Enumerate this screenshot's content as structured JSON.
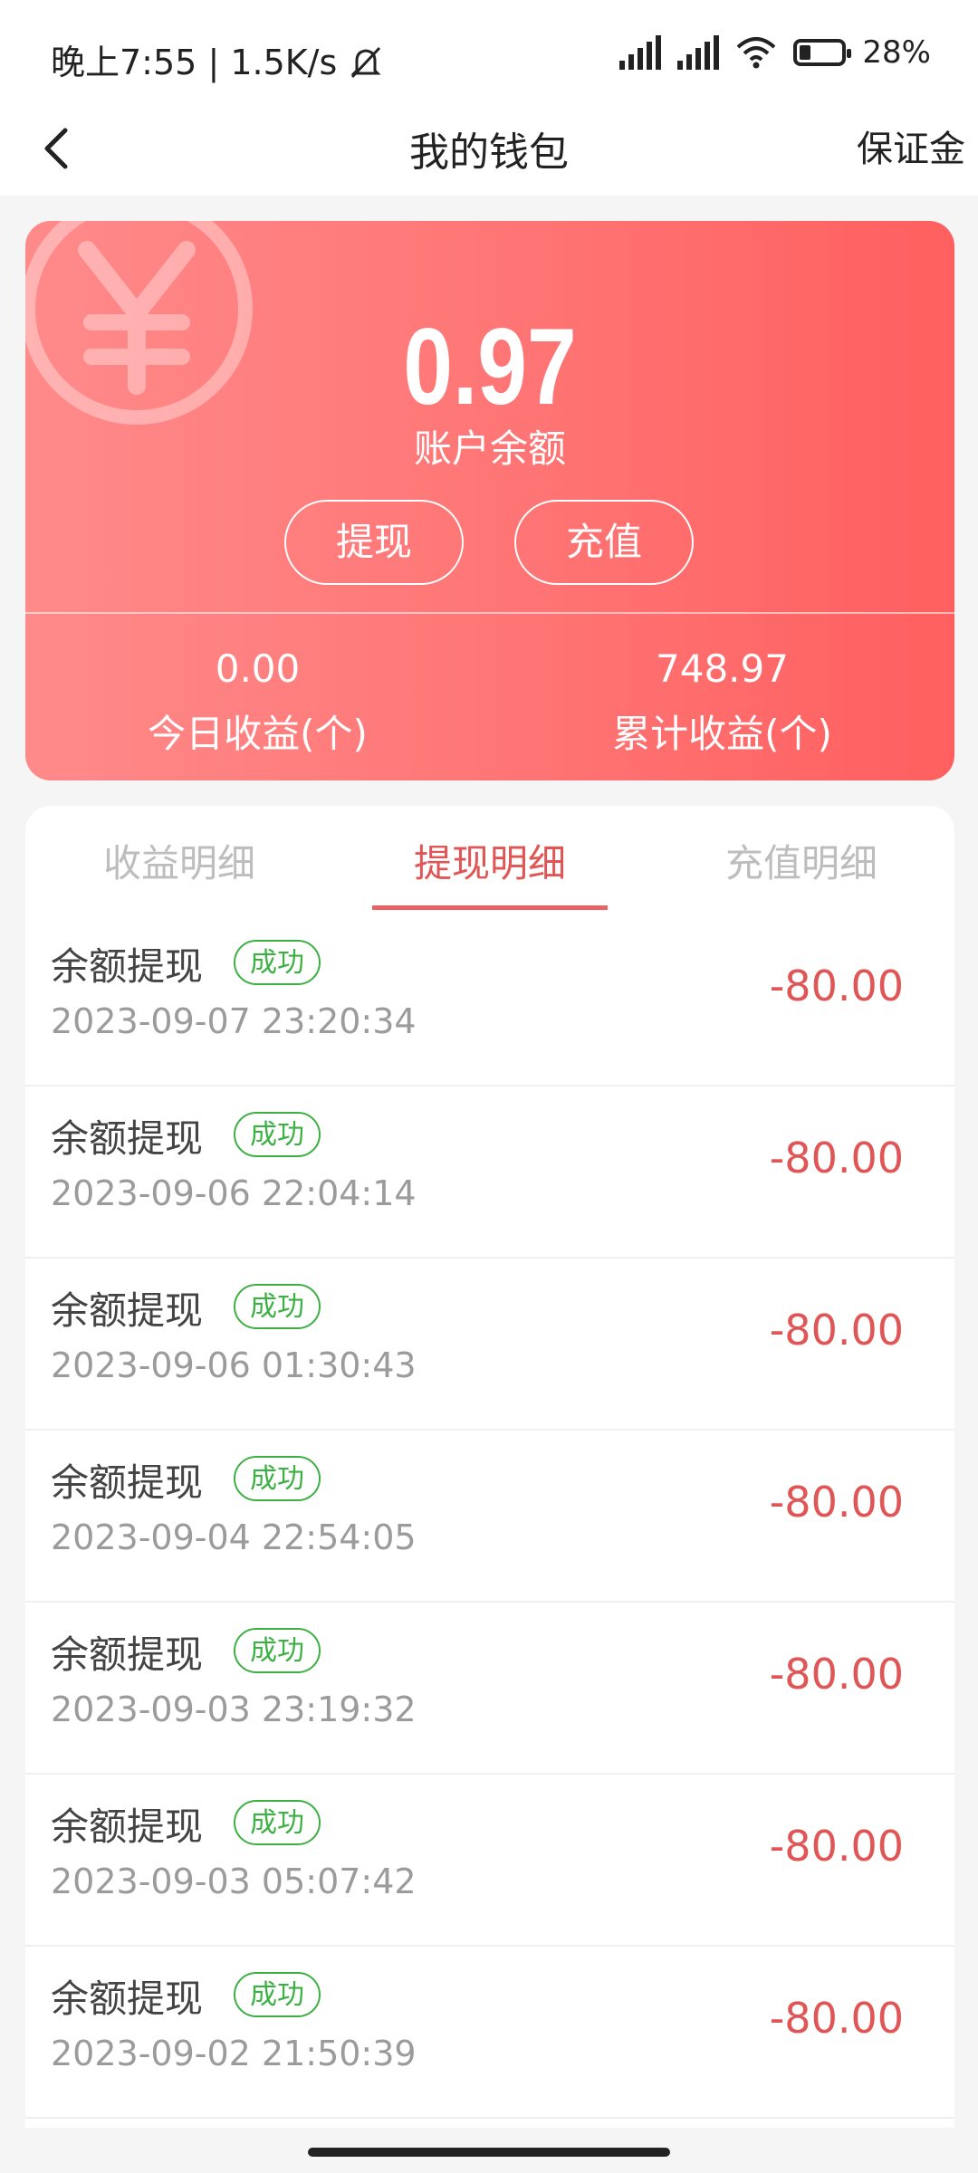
{
  "status_bar": {
    "time": "晚上7:55",
    "speed": "1.5K/s",
    "battery": "28%"
  },
  "header": {
    "title": "我的钱包",
    "right_label": "保证金"
  },
  "wallet": {
    "balance": "0.97",
    "balance_label": "账户余额",
    "withdraw_label": "提现",
    "recharge_label": "充值",
    "today_value": "0.00",
    "today_label": "今日收益(个)",
    "total_value": "748.97",
    "total_label": "累计收益(个)"
  },
  "tabs": [
    {
      "label": "收益明细",
      "active": false
    },
    {
      "label": "提现明细",
      "active": true
    },
    {
      "label": "充值明细",
      "active": false
    }
  ],
  "records": [
    {
      "name": "余额提现",
      "status": "成功",
      "time": "2023-09-07 23:20:34",
      "amount": "-80.00"
    },
    {
      "name": "余额提现",
      "status": "成功",
      "time": "2023-09-06 22:04:14",
      "amount": "-80.00"
    },
    {
      "name": "余额提现",
      "status": "成功",
      "time": "2023-09-06 01:30:43",
      "amount": "-80.00"
    },
    {
      "name": "余额提现",
      "status": "成功",
      "time": "2023-09-04 22:54:05",
      "amount": "-80.00"
    },
    {
      "name": "余额提现",
      "status": "成功",
      "time": "2023-09-03 23:19:32",
      "amount": "-80.00"
    },
    {
      "name": "余额提现",
      "status": "成功",
      "time": "2023-09-03 05:07:42",
      "amount": "-80.00"
    },
    {
      "name": "余额提现",
      "status": "成功",
      "time": "2023-09-02 21:50:39",
      "amount": "-80.00"
    }
  ],
  "colors": {
    "accent": "#e05555",
    "success": "#3cb043",
    "card_start": "#ff8a8a",
    "card_end": "#ff5f5f"
  },
  "icons": {
    "back": "chevron-left-icon",
    "mute": "bell-off-icon",
    "wifi": "wifi-icon",
    "yen": "yen-icon"
  }
}
